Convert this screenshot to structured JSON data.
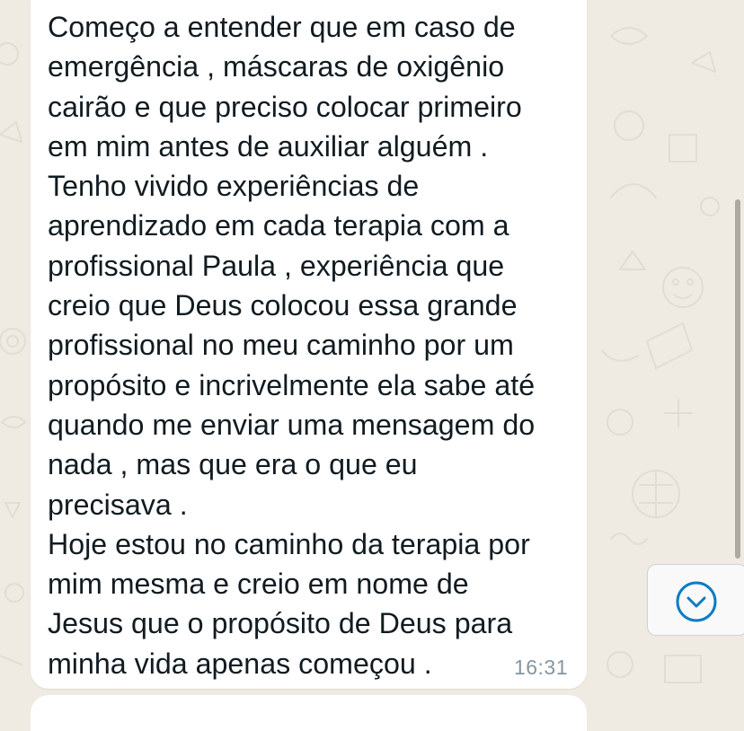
{
  "chat": {
    "background_color": "#efeae2",
    "message": {
      "text": "Começo a entender que em caso de\nemergência , máscaras de oxigênio\ncairão e que preciso colocar primeiro\nem mim antes de auxiliar alguém .\nTenho vivido experiências de\naprendizado em cada terapia com a\nprofissional Paula , experiência que\ncreio que Deus colocou essa grande\nprofissional no meu caminho por um\npropósito e incrivelmente ela sabe até\nquando me enviar uma mensagem do\nnada , mas que era o que eu\nprecisava .\nHoje estou no caminho da terapia por\nmim mesma e creio em nome de\nJesus que o propósito de Deus para\nminha vida apenas começou .",
      "time": "16:31"
    },
    "scroll_down_button": {
      "icon": "chevron-down-icon",
      "accent_color": "#0a7cc2"
    }
  }
}
